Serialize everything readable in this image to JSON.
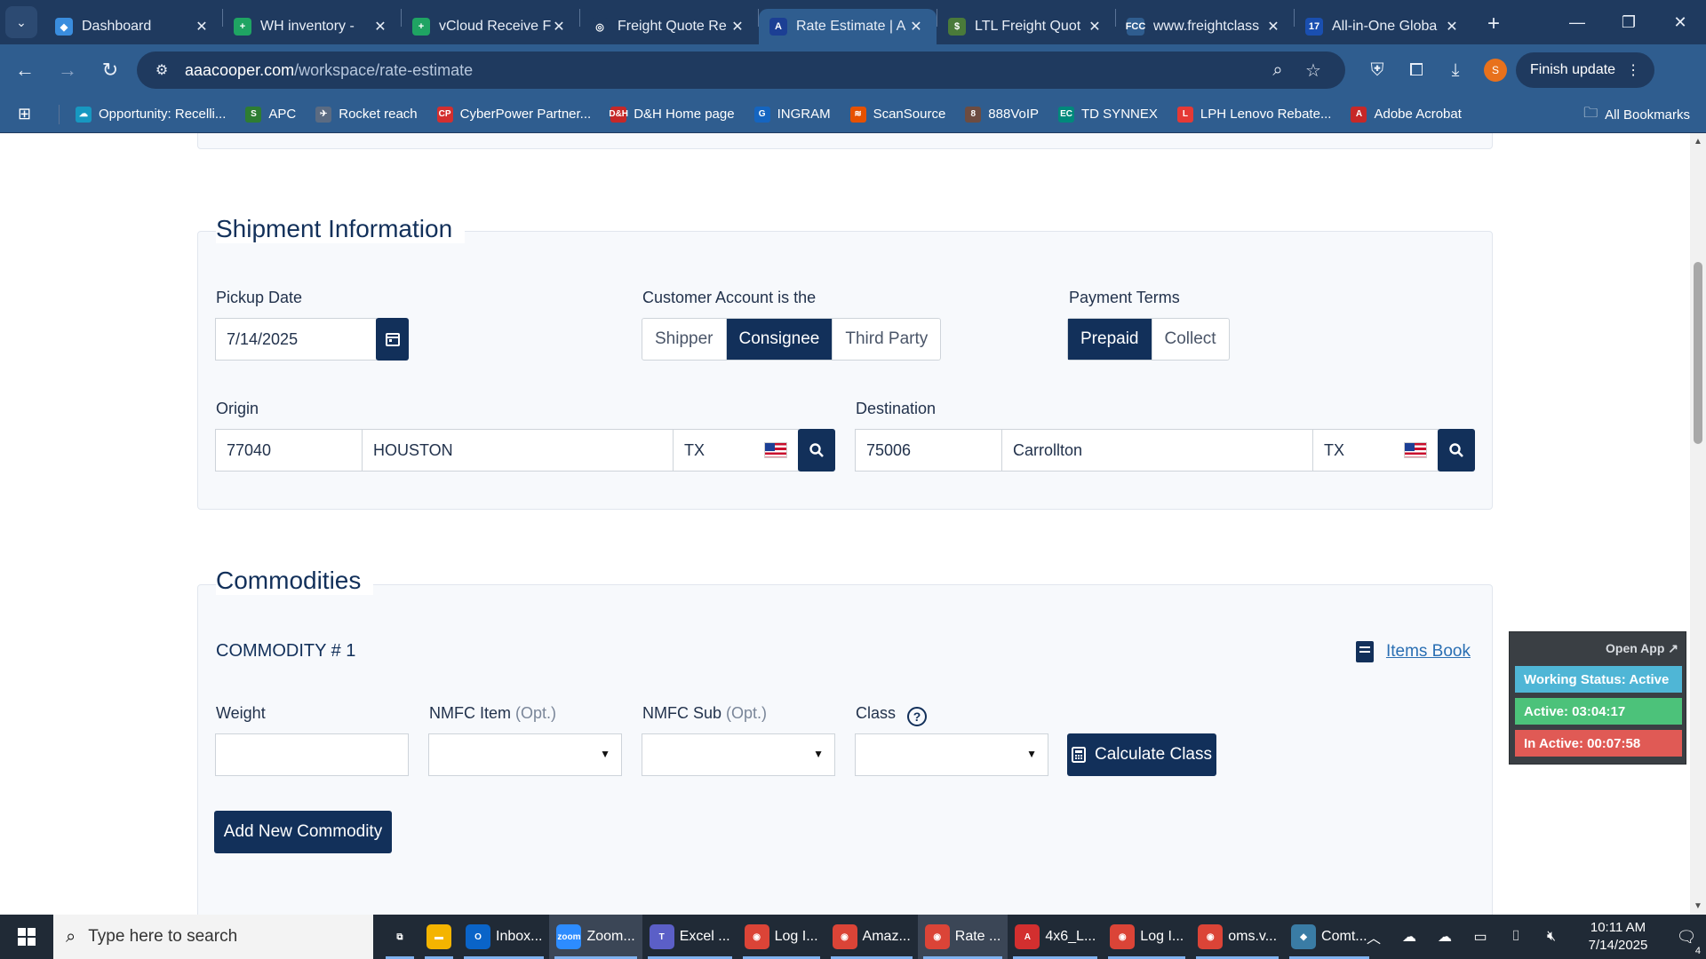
{
  "browser": {
    "tabs": [
      {
        "title": "Dashboard",
        "icon": "dashboard-favicon",
        "color": "#3a8dde",
        "glyph": "◆",
        "active": false
      },
      {
        "title": "WH inventory - ",
        "icon": "sheets-favicon",
        "color": "#1fa463",
        "glyph": "+",
        "active": false
      },
      {
        "title": "vCloud Receive F",
        "icon": "sheets-favicon",
        "color": "#1fa463",
        "glyph": "+",
        "active": false
      },
      {
        "title": "Freight Quote Re",
        "icon": "globe-favicon",
        "color": "#1f3a5f",
        "glyph": "◎",
        "active": false
      },
      {
        "title": "Rate Estimate | A",
        "icon": "aaa-cooper-favicon",
        "color": "#1c3f94",
        "glyph": "A",
        "active": true
      },
      {
        "title": "LTL Freight Quot",
        "icon": "ltl-favicon",
        "color": "#4a7a3a",
        "glyph": "$",
        "active": false
      },
      {
        "title": "www.freightclass",
        "icon": "fcc-favicon",
        "color": "#2f5d8f",
        "glyph": "FCC",
        "active": false
      },
      {
        "title": "All-in-One Globa",
        "icon": "17track-favicon",
        "color": "#1a4fb0",
        "glyph": "17",
        "active": false
      }
    ],
    "url_host": "aaacooper.com",
    "url_path": "/workspace/rate-estimate",
    "finish_update_label": "Finish update",
    "profile_initial": "S",
    "bookmarks": [
      {
        "label": "Opportunity: Recelli...",
        "color": "#1798c1",
        "glyph": "☁"
      },
      {
        "label": "APC",
        "color": "#2e7d32",
        "glyph": "S"
      },
      {
        "label": "Rocket reach",
        "color": "#5b6b82",
        "glyph": "✈"
      },
      {
        "label": "CyberPower Partner...",
        "color": "#d32f2f",
        "glyph": "CP"
      },
      {
        "label": "D&H Home page",
        "color": "#c62828",
        "glyph": "D&H"
      },
      {
        "label": "INGRAM",
        "color": "#1565c0",
        "glyph": "G"
      },
      {
        "label": "ScanSource",
        "color": "#e65100",
        "glyph": "≋"
      },
      {
        "label": "888VoIP",
        "color": "#6d4c41",
        "glyph": "8"
      },
      {
        "label": "TD SYNNEX",
        "color": "#00897b",
        "glyph": "EC"
      },
      {
        "label": "LPH Lenovo Rebate...",
        "color": "#e53935",
        "glyph": "L"
      },
      {
        "label": "Adobe Acrobat",
        "color": "#c62828",
        "glyph": "A"
      }
    ],
    "all_bookmarks_label": "All Bookmarks"
  },
  "shipment": {
    "section_title": "Shipment Information",
    "pickup_date_label": "Pickup Date",
    "pickup_date_value": "7/14/2025",
    "customer_account_label": "Customer Account is the",
    "customer_account_options": [
      "Shipper",
      "Consignee",
      "Third Party"
    ],
    "customer_account_selected": "Consignee",
    "payment_terms_label": "Payment Terms",
    "payment_terms_options": [
      "Prepaid",
      "Collect"
    ],
    "payment_terms_selected": "Prepaid",
    "origin_label": "Origin",
    "origin_zip": "77040",
    "origin_city": "HOUSTON",
    "origin_state": "TX",
    "destination_label": "Destination",
    "destination_zip": "75006",
    "destination_city": "Carrollton",
    "destination_state": "TX"
  },
  "commodities": {
    "section_title": "Commodities",
    "commodity_heading": "COMMODITY # 1",
    "items_book_label": "Items Book",
    "weight_label": "Weight",
    "weight_value": "",
    "nmfc_item_label": "NMFC Item",
    "nmfc_sub_label": "NMFC Sub",
    "opt_suffix": "(Opt.)",
    "class_label": "Class",
    "calculate_class_label": "Calculate Class",
    "add_commodity_label": "Add New Commodity"
  },
  "tracker": {
    "open_app_label": "Open App ↗",
    "working_status": "Working Status: Active",
    "active_time": "Active: 03:04:17",
    "inactive_time": "In Active: 00:07:58",
    "colors": {
      "status": "#4fb6d6",
      "active": "#4cc27a",
      "inactive": "#e05a55"
    }
  },
  "taskbar": {
    "search_placeholder": "Type here to search",
    "apps": [
      {
        "label": "",
        "icon": "task-view-icon",
        "color": "#202a36",
        "glyph": "⧉"
      },
      {
        "label": "",
        "icon": "file-explorer-icon",
        "color": "#f4b400",
        "glyph": "▬"
      },
      {
        "label": "Inbox...",
        "icon": "outlook-icon",
        "color": "#0a64c8",
        "glyph": "O"
      },
      {
        "label": "Zoom...",
        "icon": "zoom-icon",
        "color": "#2d8cff",
        "glyph": "zoom",
        "active": true
      },
      {
        "label": "Excel ...",
        "icon": "teams-icon",
        "color": "#5b5fc7",
        "glyph": "T"
      },
      {
        "label": "Log I...",
        "icon": "chrome-icon",
        "color": "#db4437",
        "glyph": "◉"
      },
      {
        "label": "Amaz...",
        "icon": "chrome-icon",
        "color": "#db4437",
        "glyph": "◉"
      },
      {
        "label": "Rate ...",
        "icon": "chrome-icon",
        "color": "#db4437",
        "glyph": "◉",
        "active": true
      },
      {
        "label": "4x6_L...",
        "icon": "acrobat-icon",
        "color": "#d32f2f",
        "glyph": "A"
      },
      {
        "label": "Log I...",
        "icon": "chrome-profile-icon",
        "color": "#db4437",
        "glyph": "◉"
      },
      {
        "label": "oms.v...",
        "icon": "chrome-profile-icon",
        "color": "#db4437",
        "glyph": "◉"
      },
      {
        "label": "Comt...",
        "icon": "app-icon",
        "color": "#3a7ca5",
        "glyph": "◆"
      }
    ],
    "time": "10:11 AM",
    "date": "7/14/2025",
    "notification_count": "4"
  }
}
